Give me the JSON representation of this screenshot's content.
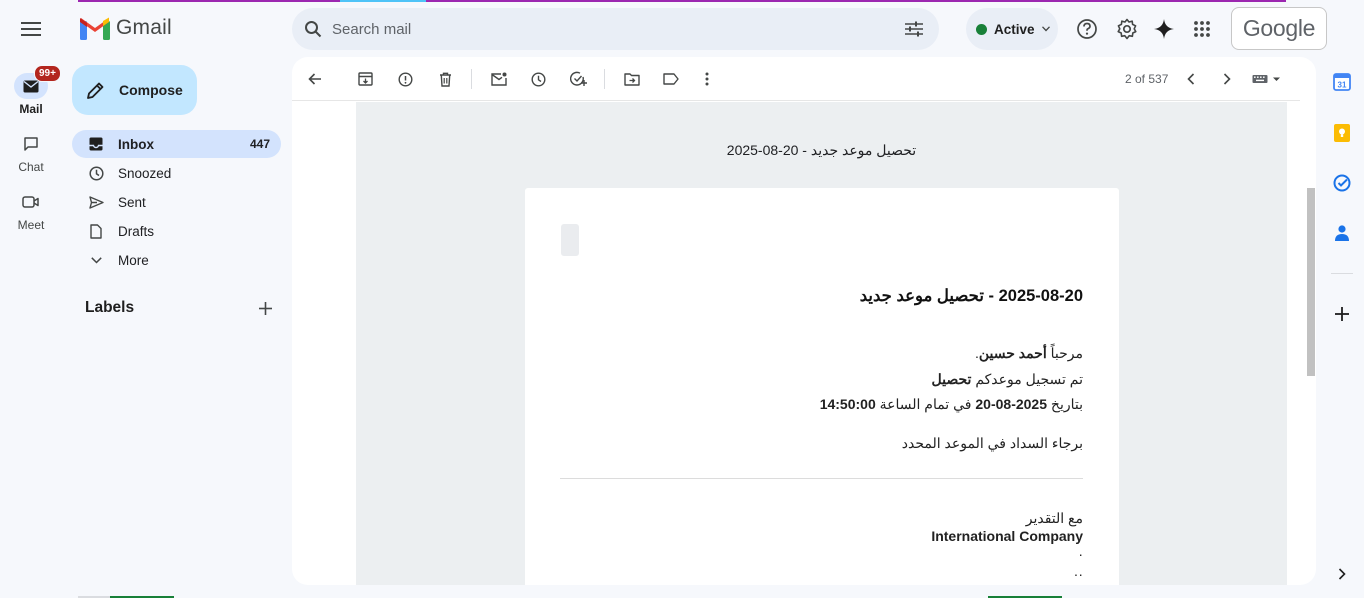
{
  "rail": {
    "items": [
      {
        "label": "Mail",
        "badge": "99+"
      },
      {
        "label": "Chat"
      },
      {
        "label": "Meet"
      }
    ]
  },
  "logo": {
    "text": "Gmail"
  },
  "search": {
    "placeholder": "Search mail"
  },
  "status": {
    "label": "Active",
    "color": "#188038"
  },
  "brand": {
    "google": "Google"
  },
  "compose": {
    "label": "Compose"
  },
  "nav": {
    "items": [
      {
        "label": "Inbox",
        "count": "447",
        "icon": "inbox-icon"
      },
      {
        "label": "Snoozed",
        "icon": "clock-icon"
      },
      {
        "label": "Sent",
        "icon": "send-icon"
      },
      {
        "label": "Drafts",
        "icon": "draft-icon"
      },
      {
        "label": "More",
        "icon": "chevron-down-icon"
      }
    ],
    "labels_heading": "Labels"
  },
  "toolbar": {
    "pager": "2 of 537"
  },
  "email": {
    "subject_line": "2025-08-20 - تحصيل موعد جديد",
    "heading": "2025-08-20 - تحصيل موعد جديد",
    "greeting_prefix": "مرحباً ",
    "greeting_name": "أحمد حسين",
    "greeting_suffix": ".",
    "registered_prefix": "تم تسجيل موعدكم ",
    "registered_type": "تحصيل",
    "date_prefix": "بتاريخ ",
    "date_value": "2025-08-20",
    "time_prefix": " في تمام الساعة ",
    "time_value": "14:50:00",
    "payment_note": "برجاء السداد في الموعد المحدد",
    "regards": "مع التقدير",
    "company": "International Company",
    "extra_line_1": "·",
    "extra_line_2": "··"
  },
  "colors": {
    "accent": "#c2e7ff",
    "selected": "#d3e3fd",
    "badge": "#b3261e"
  }
}
